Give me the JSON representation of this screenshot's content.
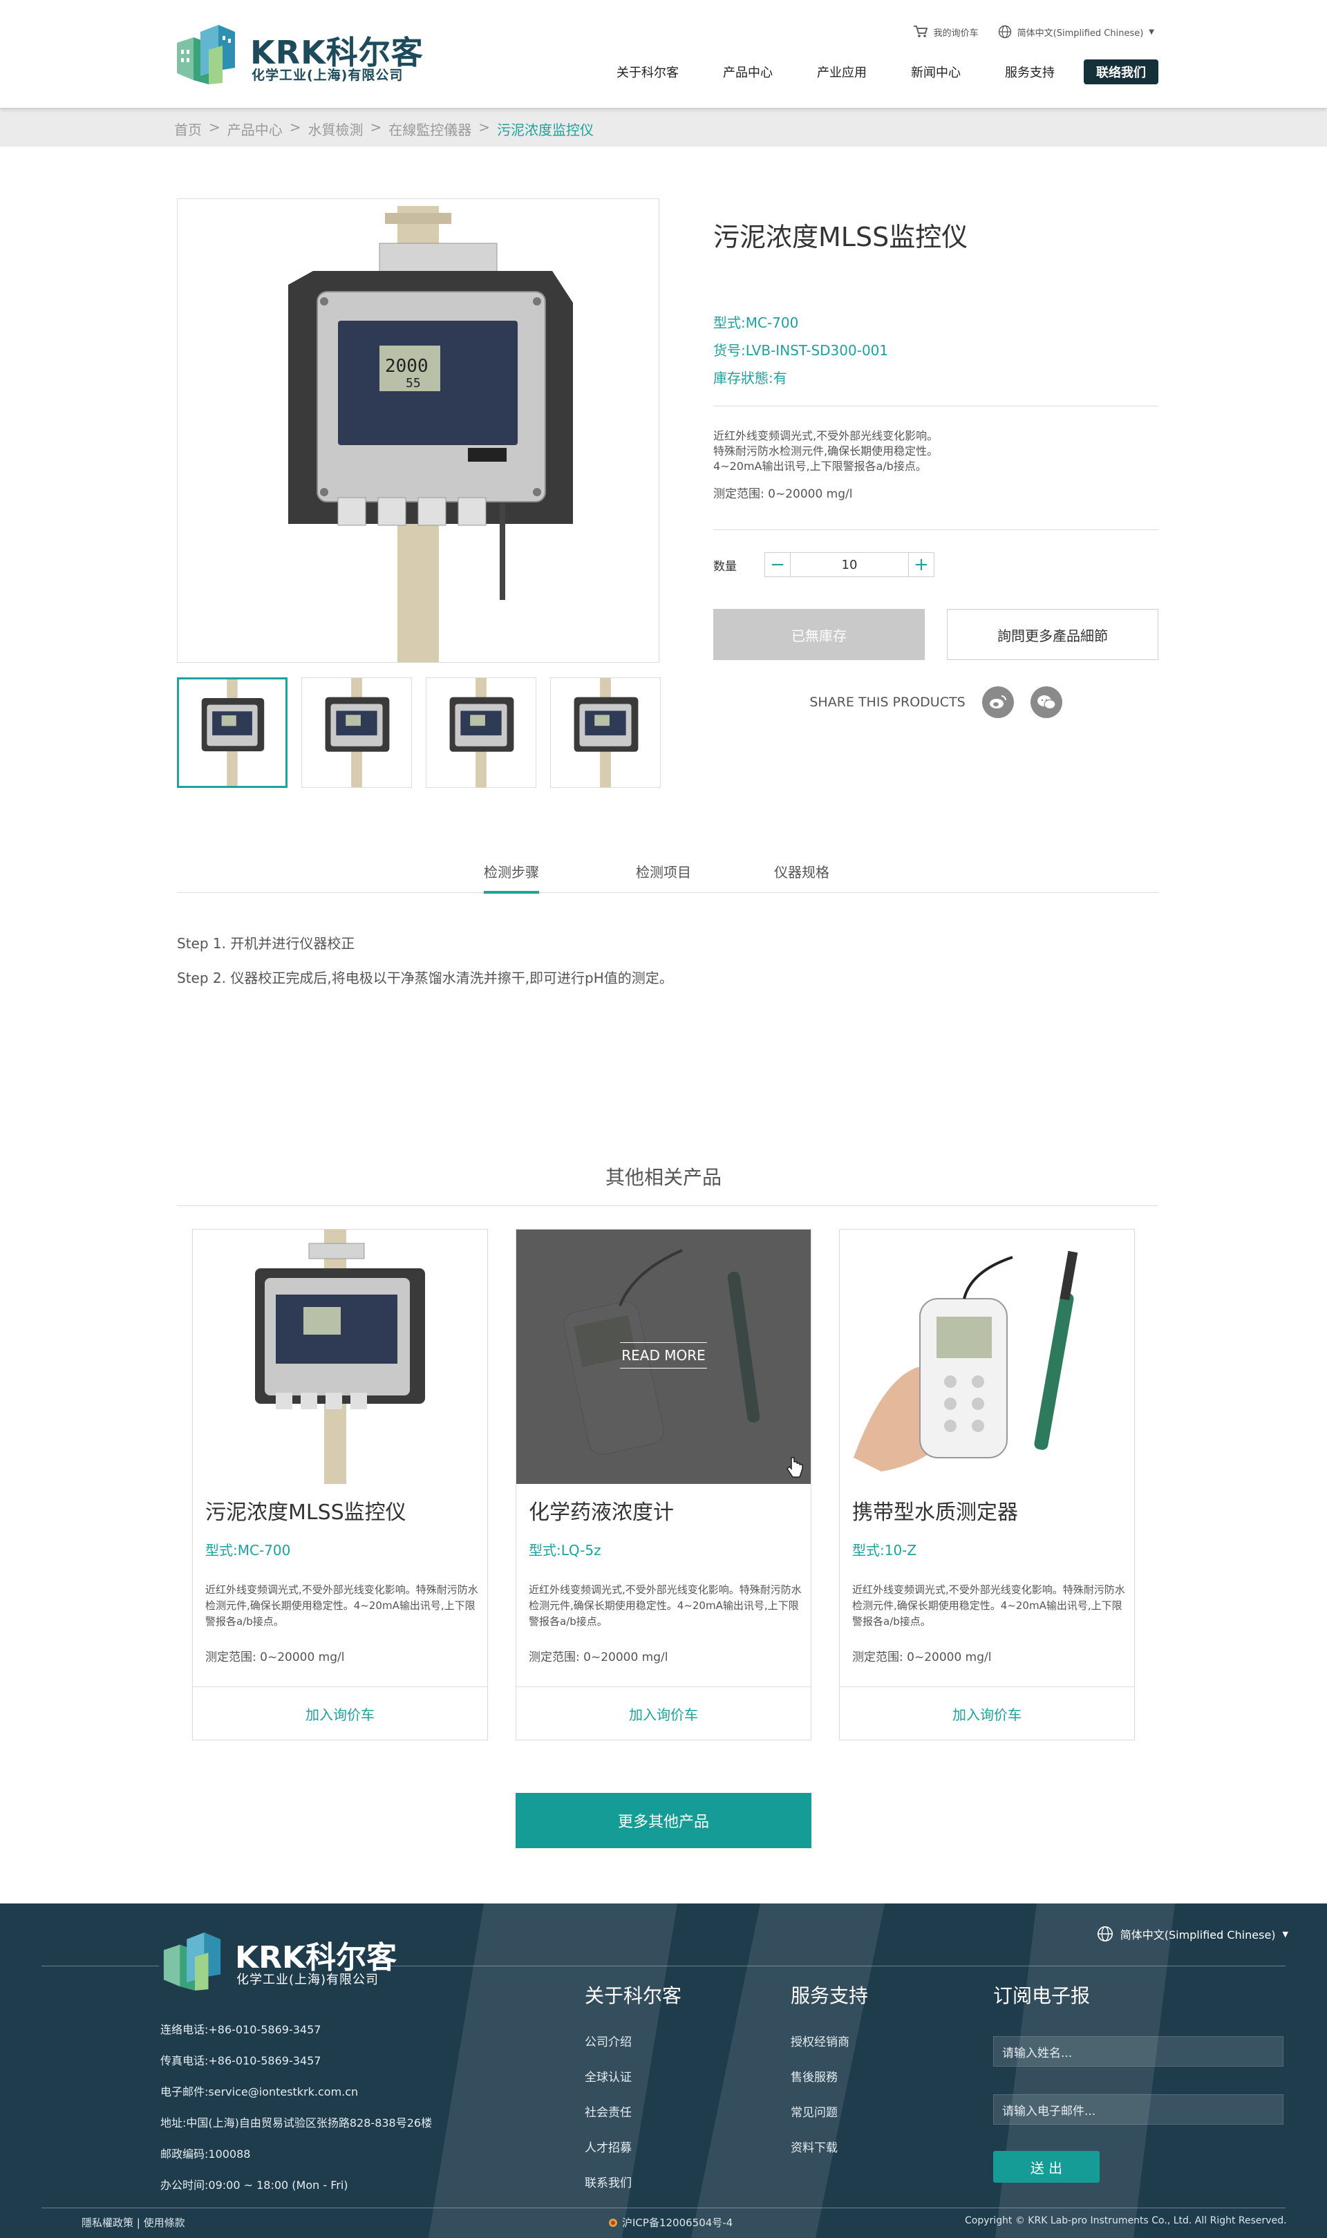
{
  "header": {
    "brand": "KRK科尔客",
    "brand_sub": "化学工业(上海)有限公司",
    "cart_label": "我的询价车",
    "language": "简体中文(Simplified Chinese)",
    "nav": [
      "关于科尔客",
      "产品中心",
      "产业应用",
      "新闻中心",
      "服务支持"
    ],
    "contact_label": "联络我们"
  },
  "breadcrumb": {
    "items": [
      "首页",
      "产品中心",
      "水質檢測",
      "在線監控儀器"
    ],
    "current": "污泥浓度监控仪",
    "separator": ">"
  },
  "product": {
    "title": "污泥浓度MLSS监控仪",
    "model": "型式:MC-700",
    "sku": "货号:LVB-INST-SD300-001",
    "stock": "庫存狀態:有",
    "desc_lines": [
      "近红外线变频调光式,不受外部光线变化影响。",
      "特殊耐污防水检测元件,确保长期使用稳定性。",
      "4~20mA输出讯号,上下限警报各a/b接点。"
    ],
    "range": "测定范围: 0~20000 mg/l",
    "qty_label": "数量",
    "qty_value": "10",
    "minus": "−",
    "plus": "+",
    "btn_out_of_stock": "已無庫存",
    "btn_inquire": "詢問更多產品細節",
    "share_label": "SHARE THIS PRODUCTS"
  },
  "tabs": [
    "检测步骤",
    "检测项目",
    "仪器规格"
  ],
  "steps": [
    "Step 1. 开机并进行仪器校正",
    "Step 2. 仪器校正完成后,将电极以干净蒸馏水清洗并擦干,即可进行pH值的测定。"
  ],
  "related": {
    "title": "其他相关产品",
    "read_more": "READ MORE",
    "cards": [
      {
        "title": "污泥浓度MLSS监控仪",
        "model": "型式:MC-700",
        "desc": "近红外线变频调光式,不受外部光线变化影响。特殊耐污防水检测元件,确保长期使用稳定性。4~20mA输出讯号,上下限警报各a/b接点。",
        "range": "测定范围: 0~20000 mg/l",
        "cart": "加入询价车"
      },
      {
        "title": "化学药液浓度计",
        "model": "型式:LQ-5z",
        "desc": "近红外线变频调光式,不受外部光线变化影响。特殊耐污防水检测元件,确保长期使用稳定性。4~20mA输出讯号,上下限警报各a/b接点。",
        "range": "测定范围: 0~20000 mg/l",
        "cart": "加入询价车"
      },
      {
        "title": "携带型水质测定器",
        "model": "型式:10-Z",
        "desc": "近红外线变频调光式,不受外部光线变化影响。特殊耐污防水检测元件,确保长期使用稳定性。4~20mA输出讯号,上下限警报各a/b接点。",
        "range": "测定范围: 0~20000 mg/l",
        "cart": "加入询价车"
      }
    ],
    "more_button": "更多其他产品"
  },
  "footer": {
    "brand": "KRK科尔客",
    "brand_sub": "化学工业(上海)有限公司",
    "language": "简体中文(Simplified Chinese)",
    "contact": [
      "连络电话:+86-010-5869-3457",
      "传真电话:+86-010-5869-3457",
      "电子邮件:service@iontestkrk.com.cn",
      "地址:中国(上海)自由贸易试验区张扬路828-838号26楼",
      "邮政编码:100088",
      "办公时间:09:00 ~ 18:00 (Mon - Fri)"
    ],
    "col_about": {
      "title": "关于科尔客",
      "links": [
        "公司介绍",
        "全球认证",
        "社会责任",
        "人才招募",
        "联系我们"
      ]
    },
    "col_service": {
      "title": "服务支持",
      "links": [
        "授权经销商",
        "售後服務",
        "常见问题",
        "资料下载"
      ]
    },
    "col_newsletter": {
      "title": "订阅电子报",
      "name_placeholder": "请输入姓名...",
      "email_placeholder": "请输入电子邮件...",
      "submit": "送 出"
    },
    "privacy": "隱私權政策 | 使用條款",
    "icp": "沪ICP备12006504号-4",
    "copyright": "Copyright © KRK Lab-pro Instruments Co., Ltd. All Right Reserved."
  },
  "colors": {
    "accent": "#1ba39c",
    "footer_bg": "#1f3c4d",
    "nav_dark": "#16303a"
  }
}
